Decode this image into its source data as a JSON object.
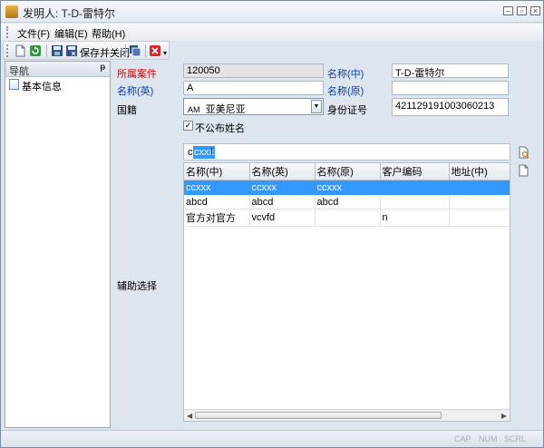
{
  "window": {
    "title": "发明人: T-D-雷特尔"
  },
  "menu": {
    "items": [
      "文件(F)",
      "编辑(E)",
      "帮助(H)"
    ]
  },
  "toolbar": {
    "save_close_label": "保存并关闭"
  },
  "nav": {
    "header": "导航",
    "pin": "ᵽ",
    "items": [
      {
        "label": "基本信息"
      }
    ]
  },
  "form": {
    "case_label": "所属案件",
    "case_value": "120050",
    "name_cn_label": "名称(中)",
    "name_cn_value": "T-D-雷特尔",
    "name_en_label": "名称(英)",
    "name_en_value": "A",
    "name_orig_label": "名称(原)",
    "name_orig_value": "",
    "nationality_label": "国籍",
    "nationality_code": "AM",
    "nationality_value": "亚美尼亚",
    "id_label": "身份证号",
    "id_value": "421129191003060213",
    "hide_name_label": "不公布姓名",
    "hide_name_checked": "✓",
    "assist_label": "辅助选择"
  },
  "search": {
    "prefix": "c",
    "selected": "cxxx"
  },
  "grid": {
    "columns": [
      "名称(中)",
      "名称(英)",
      "名称(原)",
      "客户编码",
      "地址(中)"
    ],
    "rows": [
      [
        "ccxxx",
        "ccxxx",
        "ccxxx",
        "",
        ""
      ],
      [
        "abcd",
        "abcd",
        "abcd",
        "",
        ""
      ],
      [
        "官方对官方",
        "vcvfd",
        "",
        "n",
        ""
      ]
    ],
    "selected_row": 0
  },
  "status": {
    "keys": [
      "CAP",
      "NUM",
      "SCRL"
    ]
  },
  "colors": {
    "selection": "#3399ff",
    "required_label": "#d90000",
    "optional_label": "#0a3fa8"
  }
}
